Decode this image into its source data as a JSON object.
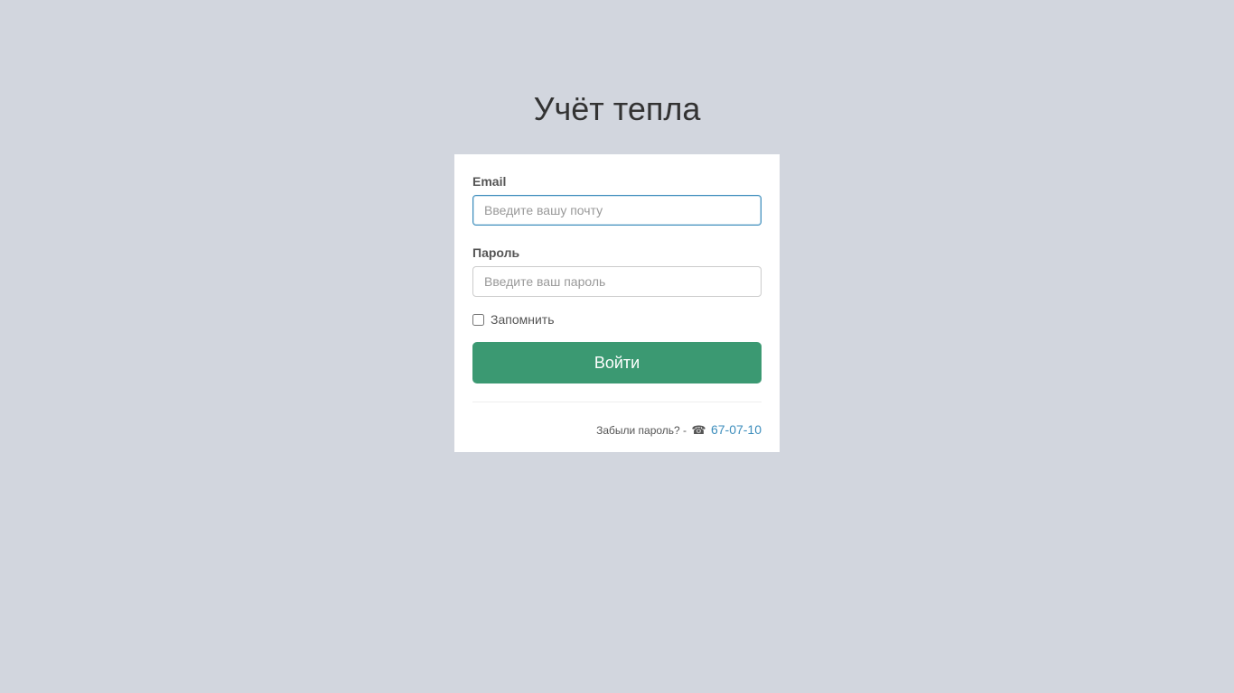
{
  "page": {
    "title": "Учёт тепла"
  },
  "form": {
    "email_label": "Email",
    "email_placeholder": "Введите вашу почту",
    "email_value": "",
    "password_label": "Пароль",
    "password_placeholder": "Введите ваш пароль",
    "password_value": "",
    "remember_label": "Запомнить",
    "remember_checked": false,
    "submit_label": "Войти"
  },
  "footer": {
    "forgot_text": "Забыли пароль? -",
    "phone_icon": "phone-icon",
    "phone_glyph": "☎",
    "phone_number": "67-07-10"
  },
  "colors": {
    "background": "#d2d6de",
    "submit": "#3b9972",
    "link": "#3c8dbc",
    "focus_border": "#3c8dbc"
  }
}
